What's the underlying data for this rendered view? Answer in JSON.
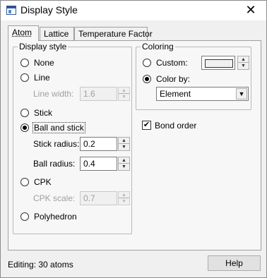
{
  "window": {
    "title": "Display Style",
    "close_label": "✕"
  },
  "tabs": [
    {
      "label": "Atom",
      "active": true
    },
    {
      "label": "Lattice",
      "active": false
    },
    {
      "label": "Temperature Factor",
      "active": false
    }
  ],
  "display_style": {
    "legend": "Display style",
    "options": {
      "none": "None",
      "line": "Line",
      "stick": "Stick",
      "ball_and_stick": "Ball and stick",
      "cpk": "CPK",
      "polyhedron": "Polyhedron"
    },
    "selected": "Ball and stick",
    "line_width": {
      "label": "Line width:",
      "value": "1.6"
    },
    "stick_radius": {
      "label": "Stick radius:",
      "value": "0.2"
    },
    "ball_radius": {
      "label": "Ball radius:",
      "value": "0.4"
    },
    "cpk_scale": {
      "label": "CPK scale:",
      "value": "0.7"
    }
  },
  "coloring": {
    "legend": "Coloring",
    "custom_label": "Custom:",
    "color_by_label": "Color by:",
    "selected": "Color by:",
    "color_by_value": "Element"
  },
  "bond_order": {
    "label": "Bond order",
    "checked": true,
    "check_glyph": "✔"
  },
  "status": "Editing: 30 atoms",
  "help_button": "Help",
  "spin_up": "▲",
  "spin_down": "▼",
  "dropdown_arrow": "▼"
}
